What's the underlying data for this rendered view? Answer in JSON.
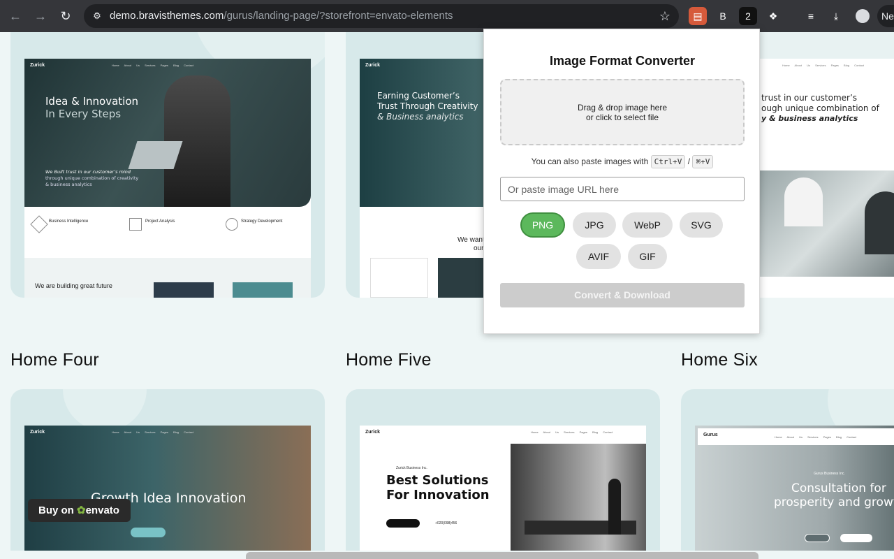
{
  "browser": {
    "url_host": "demo.bravisthemes.com",
    "url_path": "/gurus/landing-page/?storefront=envato-elements",
    "profile_initials": "Ne",
    "extensions": [
      {
        "name": "extension-1",
        "glyph": "▤"
      },
      {
        "name": "extension-2",
        "glyph": "B"
      },
      {
        "name": "extension-3",
        "glyph": "2"
      },
      {
        "name": "extensions-puzzle",
        "glyph": "❖"
      },
      {
        "name": "media-control",
        "glyph": "≡"
      },
      {
        "name": "download",
        "glyph": "⤓"
      }
    ]
  },
  "page": {
    "sections": [
      {
        "title": "Home Four"
      },
      {
        "title": "Home Five"
      },
      {
        "title": "Home Six"
      }
    ],
    "previews": {
      "one": {
        "brand": "Zurick",
        "heading_line1": "Idea & Innovation",
        "heading_line2": "In Every Steps",
        "quote_line1": "We Built trust in our customer’s mind",
        "quote_line2": "through unique combination of creativity",
        "quote_line3": "& business analytics",
        "features": [
          "Business Intelligence",
          "Project Analysis",
          "Strategy Development"
        ],
        "future": "We are building great future"
      },
      "two": {
        "brand": "Zurick",
        "heading_line1": "Earning Customer’s",
        "heading_line2": "Trust Through Creativity",
        "heading_line3": "& Business analytics",
        "snippet": "We want",
        "snippet2": "our"
      },
      "three": {
        "line1": "trust in our customer’s",
        "line2": "ough unique combination of",
        "line3": "y & business analytics"
      },
      "four": {
        "brand": "Zurick",
        "heading": "Growth Idea Innovation"
      },
      "five": {
        "brand": "Zurick",
        "kicker": "Zurick Business Inc.",
        "heading_line1": "Best Solutions",
        "heading_line2": "For Innovation",
        "phone": "+020(098)456"
      },
      "six": {
        "brand": "Gurus",
        "kicker": "Gurus Business Inc.",
        "heading_line1": "Consultation for",
        "heading_line2": "prosperity and growt"
      }
    }
  },
  "popup": {
    "title": "Image Format Converter",
    "drop_line1": "Drag & drop image here",
    "drop_line2": "or click to select file",
    "paste_hint": "You can also paste images with",
    "shortcut_win": "Ctrl+V",
    "separator": "/",
    "shortcut_mac": "⌘+V",
    "url_placeholder": "Or paste image URL here",
    "formats": [
      {
        "label": "PNG",
        "selected": true
      },
      {
        "label": "JPG",
        "selected": false
      },
      {
        "label": "WebP",
        "selected": false
      },
      {
        "label": "SVG",
        "selected": false
      },
      {
        "label": "AVIF",
        "selected": false
      },
      {
        "label": "GIF",
        "selected": false
      }
    ],
    "convert_label": "Convert & Download"
  },
  "badge": {
    "prefix": "Buy on",
    "brand": "envato"
  },
  "colors": {
    "accent_green": "#5cb85c",
    "page_bg": "#eef6f6",
    "card_bg": "#d7e9ea"
  }
}
